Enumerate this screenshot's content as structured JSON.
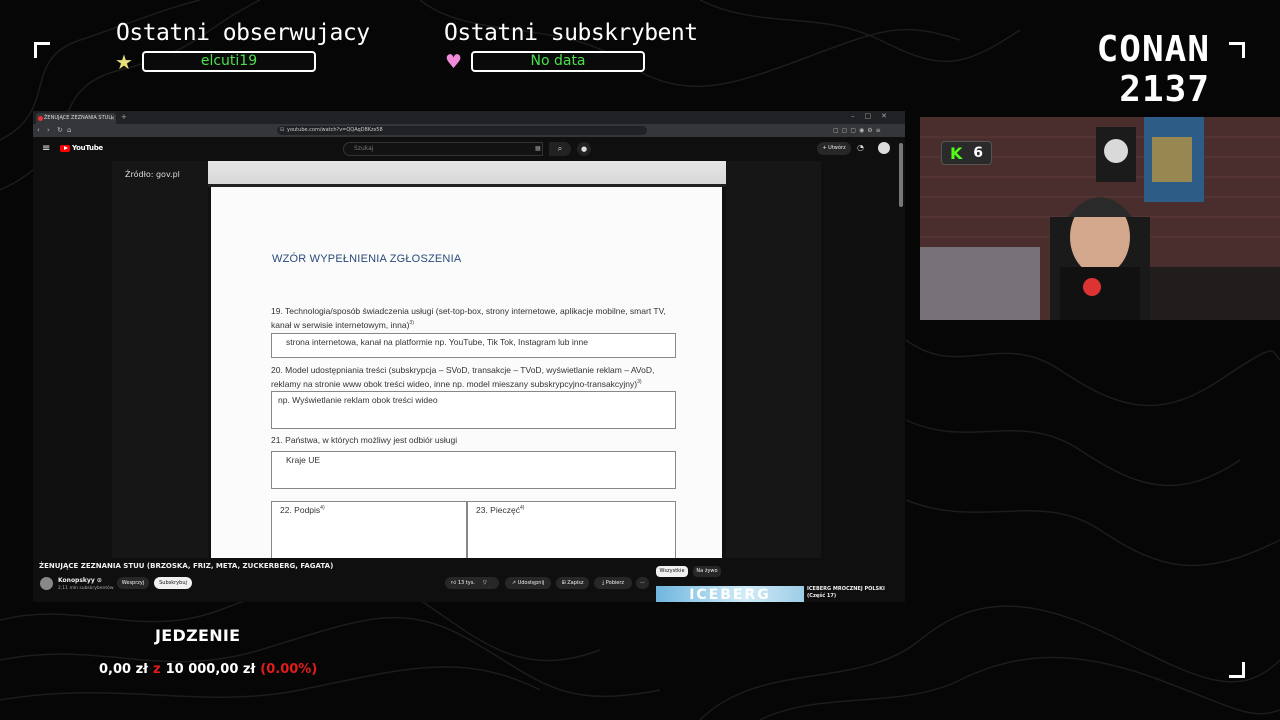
{
  "overlay": {
    "last_follower": {
      "title": "Ostatni obserwujacy",
      "value": "elcuti19",
      "icon": "star-icon"
    },
    "last_subscriber": {
      "title": "Ostatni subskrybent",
      "value": "No data",
      "icon": "heart-icon"
    },
    "brand_line1": "CONAN",
    "brand_line2": "2137",
    "kick_viewers": "6",
    "goal": {
      "title": "JEDZENIE",
      "current": "0,00 zł",
      "separator": "z",
      "target": "10 000,00 zł",
      "percent": "(0.00%)",
      "progress": 0.0
    },
    "colors": {
      "accent_green": "#4be04b",
      "goal_red": "#e21c1c",
      "kick_green": "#53fc18"
    }
  },
  "browser": {
    "tab_title": "ŻENUJĄCE ZEZNANIA STUU",
    "url": "youtube.com/watch?v=QQAqD8Kzs58"
  },
  "youtube": {
    "logo_text": "YouTube",
    "search_placeholder": "Szukaj",
    "create_label": "+ Utwórz",
    "source_label": "Źródło: gov.pl",
    "video_title": "ŻENUJĄCE ZEZNANIA STUU (BRZOSKA, FRIZ, META, ZUCKERBERG, FAGATA)",
    "channel_name": "Konopskyy ⊙",
    "channel_subs": "2,11 mln subskrybentów",
    "support_label": "Wesprzyj",
    "subscribe_label": "Subskrybuj",
    "likes_label": "13 tys.",
    "share_label": "Udostępnij",
    "save_label": "Zapisz",
    "download_label": "Pobierz",
    "chip_all": "Wszystkie",
    "chip_live": "Na żywo",
    "thumb_text": "ICEBERG",
    "rec_title": "ICEBERG MROCZNEJ POLSKI (Część 17)"
  },
  "document": {
    "heading": "WZÓR WYPEŁNIENIA ZGŁOSZENIA",
    "q19": "19. Technologia/sposób świadczenia usługi (set-top-box, strony internetowe, aplikacje mobilne, smart TV, kanał w serwisie internetowym, inna)",
    "q19_sup": "3)",
    "a19": "strona internetowa, kanał na platformie np. YouTube, Tik Tok, Instagram lub inne",
    "q20": "20. Model udostępniania treści (subskrypcja – SVoD, transakcje – TVoD, wyświetlanie reklam – AVoD, reklamy na stronie www obok treści wideo, inne np. model mieszany subskrypcyjno-transakcyjny)",
    "q20_sup": "3)",
    "a20": "np. Wyświetlanie reklam obok treści wideo",
    "q21": "21. Państwa, w których możliwy jest odbiór usługi",
    "a21": "Kraje UE",
    "q22": "22. Podpis",
    "q22_sup": "4)",
    "q23": "23. Pieczęć",
    "q23_sup": "4)"
  }
}
